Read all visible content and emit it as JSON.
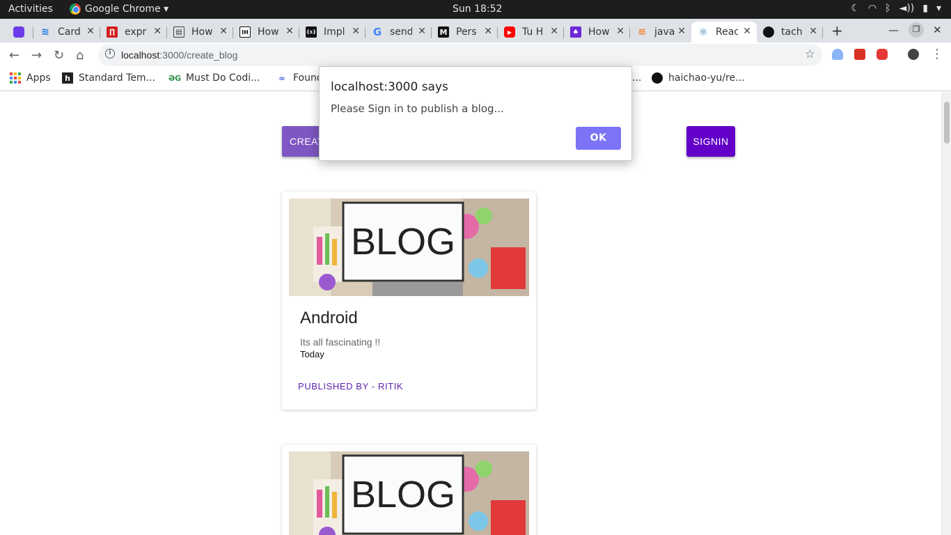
{
  "topbar": {
    "activities": "Activities",
    "app_name": "Google Chrome ▾",
    "clock": "Sun 18:52",
    "tray_icons": [
      "night-mode-icon",
      "wifi-icon",
      "bluetooth-icon",
      "volume-icon",
      "battery-icon",
      "power-menu-icon"
    ]
  },
  "tabs": [
    {
      "label": "",
      "icon": "tab-icon-d",
      "color": "#6a3de8",
      "glyph": "▶"
    },
    {
      "label": "Card",
      "icon": "tab-icon-card",
      "color": "#1a73e8",
      "glyph": "≋"
    },
    {
      "label": "expr",
      "icon": "tab-icon-expr",
      "color": "#d11f1f",
      "glyph": "▯"
    },
    {
      "label": "How",
      "icon": "tab-icon-how",
      "color": "#3c4043",
      "glyph": "▤"
    },
    {
      "label": "How",
      "icon": "tab-icon-ih",
      "color": "#111111",
      "glyph": "IH"
    },
    {
      "label": "Impl",
      "icon": "tab-icon-impl",
      "color": "#111111",
      "glyph": "{s}"
    },
    {
      "label": "send",
      "icon": "tab-icon-google",
      "color": "#ffffff",
      "glyph": "G"
    },
    {
      "label": "Pers",
      "icon": "tab-icon-medium",
      "color": "#111111",
      "glyph": "M"
    },
    {
      "label": "Tu H",
      "icon": "tab-icon-youtube",
      "color": "#ff0000",
      "glyph": "▶"
    },
    {
      "label": "How",
      "icon": "tab-icon-how2",
      "color": "#6d28d9",
      "glyph": "♠"
    },
    {
      "label": "java",
      "icon": "tab-icon-stackoverflow",
      "color": "#ffffff",
      "glyph": "≡"
    },
    {
      "label": "Reac",
      "icon": "tab-icon-react",
      "color": "#ffffff",
      "glyph": "⚛"
    },
    {
      "label": "tach",
      "icon": "tab-icon-github",
      "color": "#ffffff",
      "glyph": "●"
    }
  ],
  "toolbar": {
    "url_host": "localhost",
    "url_rest": ":3000/create_blog"
  },
  "bookmarks": [
    {
      "label": "Apps",
      "icon": "apps-grid-icon"
    },
    {
      "label": "Standard Tem...",
      "icon": "hashnode-icon"
    },
    {
      "label": "Must Do Codi...",
      "icon": "geeksforgeeks-icon"
    },
    {
      "label": "Found",
      "icon": "link-icon"
    },
    {
      "label": "...",
      "icon": ""
    },
    {
      "label": "haichao-yu/re...",
      "icon": "github-icon"
    }
  ],
  "page": {
    "create_button": "CREATE BLOG",
    "signin_button": "SIGNIN"
  },
  "cards": [
    {
      "image_text": "BLOG",
      "title": "Android",
      "description": "Its all fascinating !!",
      "date": "Today",
      "published_by": "PUBLISHED BY - RITIK"
    },
    {
      "image_text": "BLOG",
      "title": "",
      "description": "",
      "date": "",
      "published_by": ""
    }
  ],
  "dialog": {
    "title": "localhost:3000 says",
    "message": "Please Sign in to publish a blog...",
    "ok_label": "OK"
  }
}
